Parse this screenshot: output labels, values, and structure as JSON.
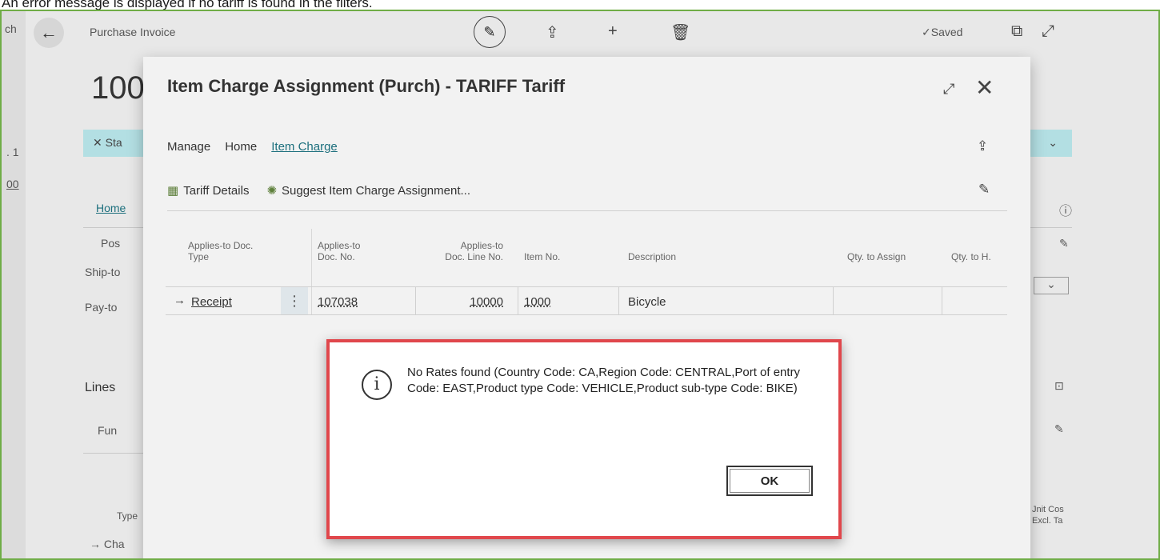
{
  "caption": "An error message is displayed if no tariff is found in the filters.",
  "background": {
    "breadcrumb": "Purchase Invoice",
    "saved": "✓Saved",
    "doc_title": "100",
    "teal_bar_label": "✕  Sta",
    "home_tab": "Home",
    "post_button": "Pos",
    "ship_to": "Ship-to",
    "pay_to": "Pay-to",
    "lines_heading": "Lines",
    "functions": "Fun",
    "type_col": "Type",
    "row_type": "Cha",
    "unit_cost_col": "Jnit Cos Excl. Ta",
    "edge_text_1": "ch",
    "edge_text_2": ". 1",
    "edge_text_3": "00"
  },
  "dialog": {
    "title": "Item Charge Assignment (Purch) - TARIFF Tariff",
    "menu": [
      "Manage",
      "Home",
      "Item Charge"
    ],
    "actions": {
      "tariff_details": "Tariff Details",
      "suggest": "Suggest Item Charge Assignment..."
    },
    "columns": {
      "doc_type": "Applies-to Doc. Type",
      "doc_no": "Applies-to Doc. No.",
      "line_no": "Applies-to Doc. Line No.",
      "item_no": "Item No.",
      "description": "Description",
      "qty_assign": "Qty. to Assign",
      "qty_handle": "Qty. to H."
    },
    "row": {
      "doc_type": "Receipt",
      "doc_no": "107038",
      "line_no": "10000",
      "item_no": "1000",
      "description": "Bicycle"
    }
  },
  "message": {
    "text": "No Rates found (Country Code: CA,Region Code: CENTRAL,Port of entry Code: EAST,Product type Code: VEHICLE,Product sub-type Code: BIKE)",
    "ok": "OK"
  }
}
